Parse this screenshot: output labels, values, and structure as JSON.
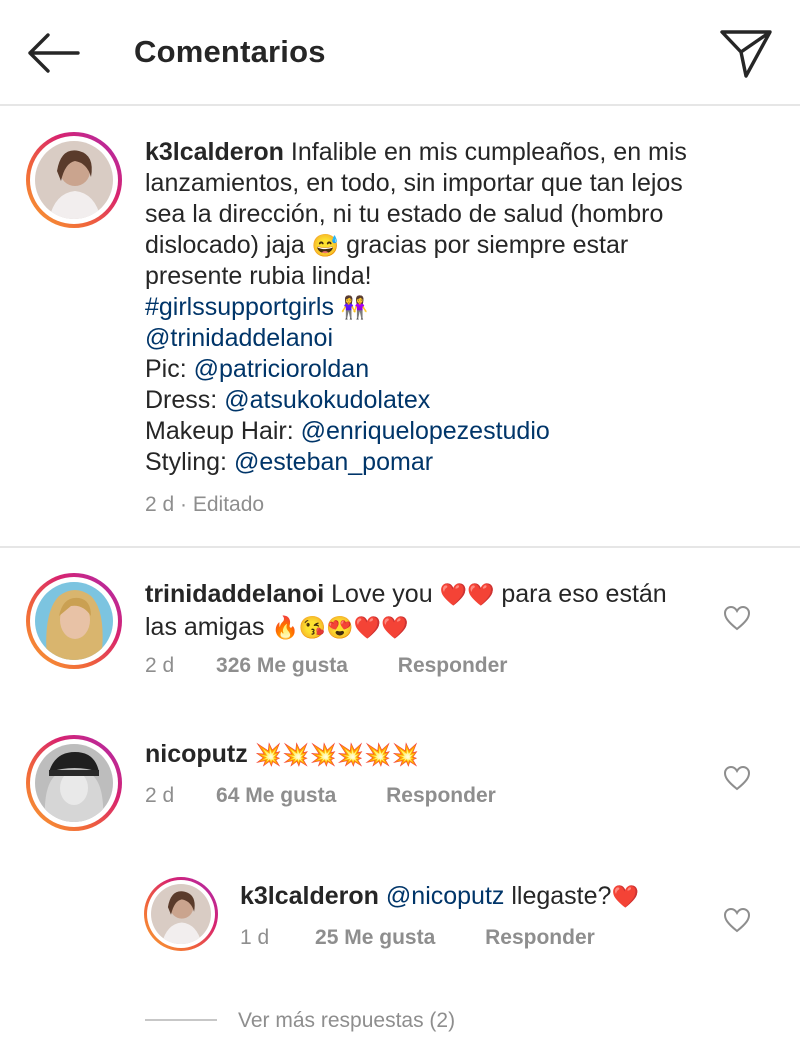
{
  "header": {
    "title": "Comentarios",
    "back_icon": "arrow-left-icon",
    "share_icon": "paper-plane-icon"
  },
  "caption": {
    "username": "k3lcalderon",
    "lines": [
      "Infalible en mis cumpleaños, en mis",
      "lanzamientos, en todo, sin importar que tan lejos",
      "sea la dirección, ni tu estado de salud (hombro",
      "dislocado) jaja",
      "gracias por siempre estar",
      "presente rubia linda!"
    ],
    "emoji_sweat": "😅",
    "hashtag": "#girlssupportgirls",
    "hashtag_emoji": "👭",
    "mention_main": "@trinidaddelanoi",
    "credits": [
      {
        "label": "Pic:",
        "handle": "@patricioroldan"
      },
      {
        "label": "Dress:",
        "handle": "@atsukokudolatex"
      },
      {
        "label": "Makeup Hair:",
        "handle": "@enriquelopezestudio"
      },
      {
        "label": "Styling:",
        "handle": "@esteban_pomar"
      }
    ],
    "time": "2 d",
    "edited": "· Editado"
  },
  "comments": [
    {
      "username": "trinidaddelanoi",
      "text_part1": "Love you",
      "emoji_part1": "❤️❤️",
      "text_part2": "para eso están",
      "text_line2": "las amigas",
      "emoji_line2": "🔥😘😍❤️❤️",
      "time": "2 d",
      "likes": "326 Me gusta",
      "reply": "Responder"
    },
    {
      "username": "nicoputz",
      "emoji": "💥💥💥💥💥💥",
      "time": "2 d",
      "likes": "64 Me gusta",
      "reply": "Responder"
    }
  ],
  "reply": {
    "username": "k3lcalderon",
    "mention": "@nicoputz",
    "text": "llegaste?",
    "emoji": "❤️",
    "time": "1 d",
    "likes": "25 Me gusta",
    "reply": "Responder"
  },
  "more_replies": "Ver más respuestas (2)",
  "colors": {
    "link": "#003569",
    "muted": "#8e8e8e",
    "text": "#262626",
    "heart": "#e0182d"
  }
}
